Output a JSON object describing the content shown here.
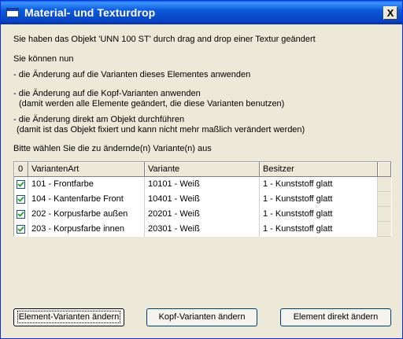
{
  "window": {
    "title": "Material- und Texturdrop",
    "close_label": "X"
  },
  "message": {
    "line1": "Sie haben das Objekt 'UNN 100 ST' durch drag and drop einer Textur geändert",
    "line2": "Sie können nun",
    "option1": "- die Änderung auf die Varianten dieses Elementes anwenden",
    "option2": "- die Änderung auf die Kopf-Varianten anwenden",
    "option2_note": "(damit werden alle Elemente geändert, die diese Varianten benutzen)",
    "option3": "- die Änderung direkt am Objekt durchführen",
    "option3_note": "(damit ist das Objekt fixiert und kann nicht mehr maßlich verändert werden)",
    "prompt": "Bitte wählen Sie die zu ändernde(n) Variante(n) aus"
  },
  "table": {
    "headers": [
      "0",
      "VariantenArt",
      "Variante",
      "Besitzer"
    ],
    "rows": [
      {
        "checked": true,
        "art": "101 - Frontfarbe",
        "variante": "10101 - Weiß",
        "besitzer": "1 - Kunststoff glatt"
      },
      {
        "checked": true,
        "art": "104 - Kantenfarbe Front",
        "variante": "10401 - Weiß",
        "besitzer": "1 - Kunststoff glatt"
      },
      {
        "checked": true,
        "art": "202 - Korpusfarbe außen",
        "variante": "20201 - Weiß",
        "besitzer": "1 - Kunststoff glatt"
      },
      {
        "checked": true,
        "art": "203 - Korpusfarbe innen",
        "variante": "20301 - Weiß",
        "besitzer": "1 - Kunststoff glatt"
      }
    ]
  },
  "buttons": {
    "element": "Element-Varianten ändern",
    "kopf": "Kopf-Varianten ändern",
    "direkt": "Element direkt ändern"
  },
  "colors": {
    "titlebar": "#0842c3",
    "face": "#ece9d8",
    "check": "#21a121"
  }
}
